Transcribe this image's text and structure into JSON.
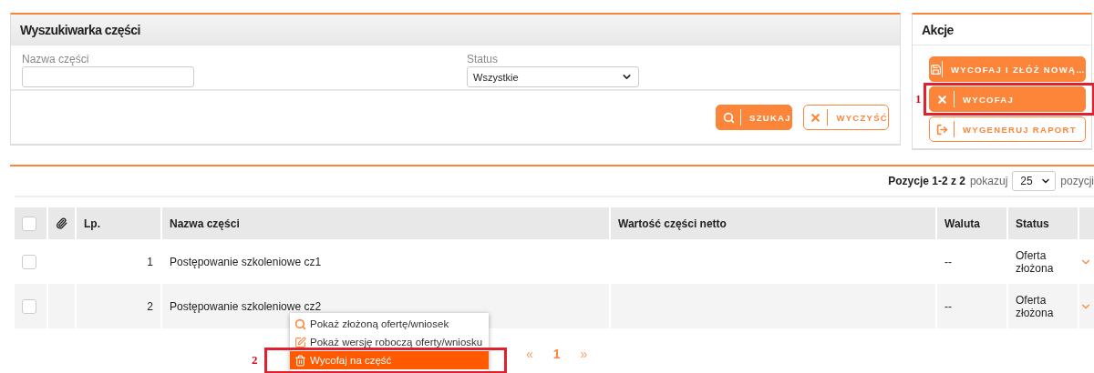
{
  "search_panel": {
    "title": "Wyszukiwarka części",
    "fields": [
      {
        "kind": "text",
        "label": "Nazwa części"
      },
      {
        "kind": "select",
        "label": "Status",
        "value": "Wszystkie"
      }
    ],
    "buttons": [
      {
        "kind": "primary",
        "label": "SZUKAJ"
      },
      {
        "kind": "outline",
        "label": "WYCZYŚĆ"
      }
    ]
  },
  "actions_panel": {
    "title": "Akcje",
    "buttons": [
      {
        "kind": "primary",
        "label": "WYCOFAJ I ZŁÓŻ NOWĄ…"
      },
      {
        "kind": "primary",
        "label": "WYCOFAJ",
        "annotation": "1"
      },
      {
        "kind": "outline",
        "label": "WYGENERUJ RAPORT"
      }
    ]
  },
  "table": {
    "summary": "Pozycje 1-2 z 2",
    "show_label": "pokazuj",
    "page_size": "25",
    "page_size_suffix": "pozycji",
    "select_all_checked": false,
    "columns": [
      "Lp.",
      "Nazwa części",
      "Wartość części netto",
      "Waluta",
      "Status"
    ],
    "rows": [
      {
        "checked": false,
        "lp": "1",
        "name": "Postępowanie szkoleniowe cz1",
        "currency": "--",
        "status": "Oferta złożona"
      },
      {
        "checked": false,
        "lp": "2",
        "name": "Postępowanie szkoleniowe cz2",
        "currency": "--",
        "status": "Oferta złożona"
      }
    ]
  },
  "context_menu": {
    "annotation": "2",
    "items": [
      {
        "label": "Pokaż złożoną ofertę/wniosek",
        "selected": false
      },
      {
        "label": "Pokaż wersję roboczą oferty/wniosku",
        "selected": false
      },
      {
        "label": "Wycofaj na część",
        "selected": true
      }
    ]
  },
  "pagination": {
    "first": "«",
    "pages": [
      {
        "label": "1",
        "selected": true
      }
    ],
    "next": "»"
  }
}
